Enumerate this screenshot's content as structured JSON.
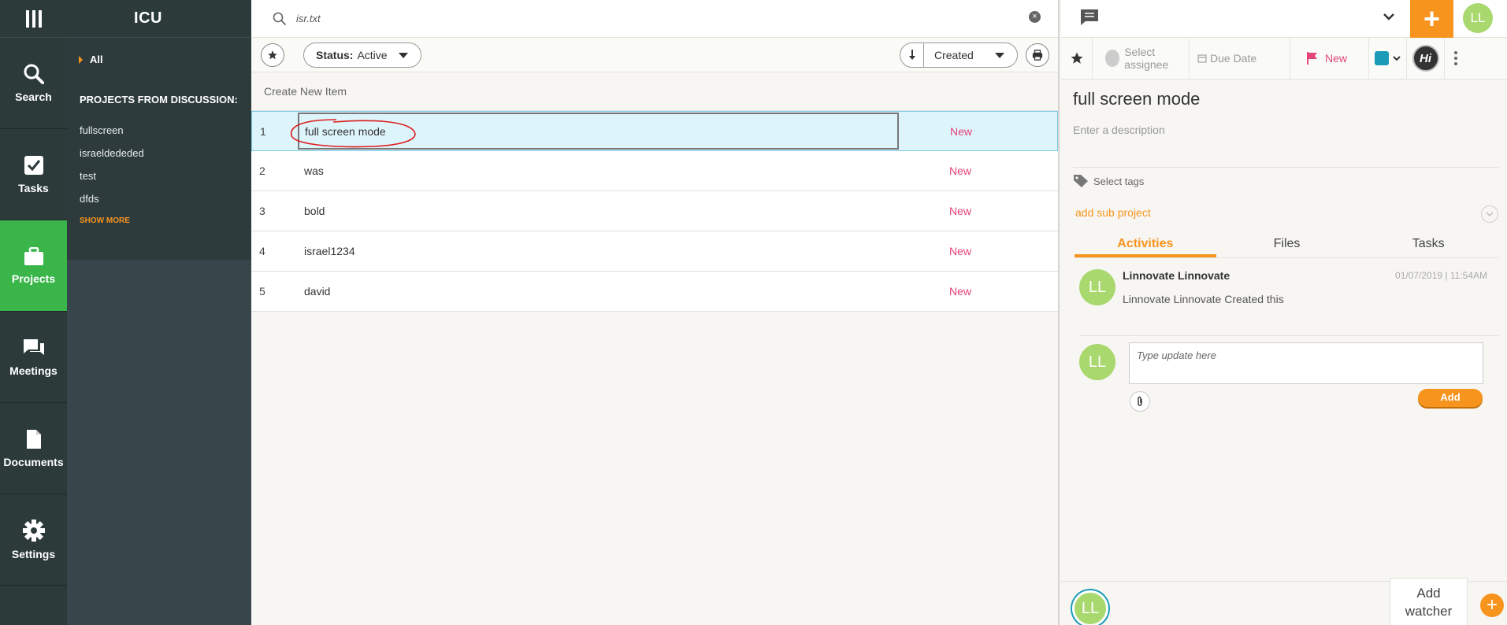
{
  "app": {
    "name": "ICU"
  },
  "nav": {
    "items": [
      {
        "label": "Search",
        "icon": "search-icon"
      },
      {
        "label": "Tasks",
        "icon": "checkbox-icon"
      },
      {
        "label": "Projects",
        "icon": "briefcase-icon",
        "active": true
      },
      {
        "label": "Meetings",
        "icon": "chat-bubbles-icon"
      },
      {
        "label": "Documents",
        "icon": "document-icon"
      },
      {
        "label": "Settings",
        "icon": "gear-icon"
      }
    ]
  },
  "sidebar": {
    "all_label": "All",
    "section_title": "PROJECTS FROM DISCUSSION:",
    "projects": [
      "fullscreen",
      "israeldededed",
      "test",
      "dfds"
    ],
    "show_more": "SHOW MORE"
  },
  "search": {
    "value": "isr.txt"
  },
  "toolbar": {
    "status_label": "Status:",
    "status_value": "Active",
    "sort_value": "Created"
  },
  "list": {
    "create_label": "Create New Item",
    "rows": [
      {
        "num": "1",
        "title": "full screen mode",
        "status": "New"
      },
      {
        "num": "2",
        "title": "was",
        "status": "New"
      },
      {
        "num": "3",
        "title": "bold",
        "status": "New"
      },
      {
        "num": "4",
        "title": "israel1234",
        "status": "New"
      },
      {
        "num": "5",
        "title": "david",
        "status": "New"
      }
    ]
  },
  "detail": {
    "user_initials": "LL",
    "assignee_placeholder": "Select assignee",
    "due_date_placeholder": "Due Date",
    "status": "New",
    "title": "full screen mode",
    "description_placeholder": "Enter a description",
    "tags_placeholder": "Select tags",
    "add_sub_project": "add sub project",
    "tabs": [
      "Activities",
      "Files",
      "Tasks"
    ],
    "activity": {
      "author": "Linnovate Linnovate",
      "date": "01/07/2019 | 11:54AM",
      "text": "Linnovate Linnovate Created this"
    },
    "update_placeholder": "Type update here",
    "add_label": "Add",
    "add_watcher_line1": "Add",
    "add_watcher_line2": "watcher"
  },
  "colors": {
    "accent": "#f7941d",
    "active_nav": "#3ab54a",
    "status_new": "#e5447a",
    "selected_row": "#def4fb"
  }
}
